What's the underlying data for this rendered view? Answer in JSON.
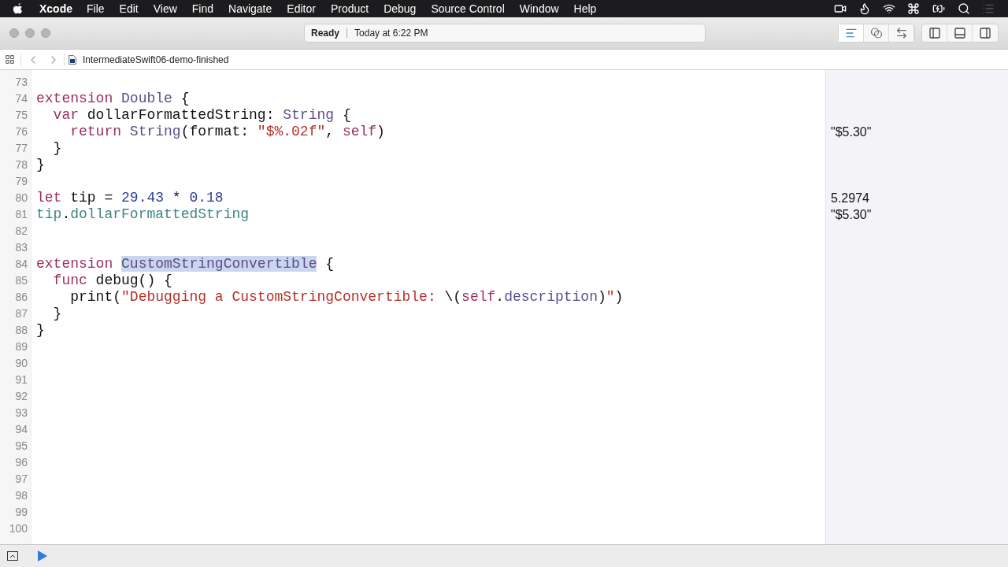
{
  "menu_bar": {
    "app": "Xcode",
    "items": [
      "File",
      "Edit",
      "View",
      "Find",
      "Navigate",
      "Editor",
      "Product",
      "Debug",
      "Source Control",
      "Window",
      "Help"
    ]
  },
  "activity": {
    "status": "Ready",
    "time": "Today at 6:22 PM"
  },
  "toolbar": {
    "editor_modes": [
      {
        "selected": true
      },
      {
        "selected": false
      },
      {
        "selected": false
      }
    ]
  },
  "jump_bar": {
    "file": "IntermediateSwift06-demo-finished"
  },
  "editor": {
    "lines": [
      {
        "number": "73"
      },
      {
        "number": "74",
        "tokens": [
          {
            "kind": "keyword",
            "text": "extension "
          },
          {
            "kind": "type",
            "text": "Double"
          },
          {
            "kind": "plain",
            "text": " {"
          }
        ]
      },
      {
        "number": "75",
        "tokens": [
          {
            "kind": "keyword",
            "text": "  var"
          },
          {
            "kind": "plain",
            "text": " dollarFormattedString: "
          },
          {
            "kind": "type",
            "text": "String"
          },
          {
            "kind": "plain",
            "text": " {"
          }
        ]
      },
      {
        "number": "76",
        "tokens": [
          {
            "kind": "keyword",
            "text": "    return "
          },
          {
            "kind": "type",
            "text": "String"
          },
          {
            "kind": "plain",
            "text": "(format: "
          },
          {
            "kind": "string",
            "text": "\"$%.02f\""
          },
          {
            "kind": "plain",
            "text": ", "
          },
          {
            "kind": "keyword",
            "text": "self"
          },
          {
            "kind": "plain",
            "text": ")"
          }
        ],
        "result": "\"$5.30\""
      },
      {
        "number": "77",
        "tokens": [
          {
            "kind": "plain",
            "text": "  }"
          }
        ]
      },
      {
        "number": "78",
        "tokens": [
          {
            "kind": "plain",
            "text": "}"
          }
        ]
      },
      {
        "number": "79"
      },
      {
        "number": "80",
        "tokens": [
          {
            "kind": "keyword",
            "text": "let"
          },
          {
            "kind": "plain",
            "text": " tip = "
          },
          {
            "kind": "number",
            "text": "29.43"
          },
          {
            "kind": "plain",
            "text": " * "
          },
          {
            "kind": "number",
            "text": "0.18"
          }
        ],
        "result": "5.2974"
      },
      {
        "number": "81",
        "tokens": [
          {
            "kind": "member",
            "text": "tip"
          },
          {
            "kind": "plain",
            "text": "."
          },
          {
            "kind": "member",
            "text": "dollarFormattedString"
          }
        ],
        "result": "\"$5.30\""
      },
      {
        "number": "82"
      },
      {
        "number": "83"
      },
      {
        "number": "84",
        "tokens": [
          {
            "kind": "keyword",
            "text": "extension ",
            "selected": false
          },
          {
            "kind": "type",
            "text": "CustomStringConvertible",
            "selected": true
          },
          {
            "kind": "plain",
            "text": " {",
            "selected": false
          }
        ]
      },
      {
        "number": "85",
        "tokens": [
          {
            "kind": "keyword",
            "text": "  func"
          },
          {
            "kind": "plain",
            "text": " debug() {"
          }
        ]
      },
      {
        "number": "86",
        "tokens": [
          {
            "kind": "plain",
            "text": "    print("
          },
          {
            "kind": "string",
            "text": "\"Debugging a CustomStringConvertible: "
          },
          {
            "kind": "plain",
            "text": "\\("
          },
          {
            "kind": "keyword",
            "text": "self"
          },
          {
            "kind": "plain",
            "text": "."
          },
          {
            "kind": "type",
            "text": "description"
          },
          {
            "kind": "plain",
            "text": ")"
          },
          {
            "kind": "string",
            "text": "\""
          },
          {
            "kind": "plain",
            "text": ")"
          }
        ]
      },
      {
        "number": "87",
        "tokens": [
          {
            "kind": "plain",
            "text": "  }"
          }
        ]
      },
      {
        "number": "88",
        "tokens": [
          {
            "kind": "plain",
            "text": "}"
          }
        ]
      },
      {
        "number": "89"
      },
      {
        "number": "90"
      },
      {
        "number": "91"
      },
      {
        "number": "92"
      },
      {
        "number": "93"
      },
      {
        "number": "94"
      },
      {
        "number": "95"
      },
      {
        "number": "96"
      },
      {
        "number": "97"
      },
      {
        "number": "98"
      },
      {
        "number": "99"
      },
      {
        "number": "100"
      }
    ]
  }
}
